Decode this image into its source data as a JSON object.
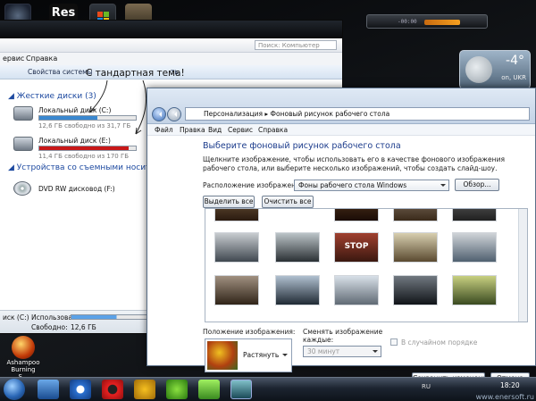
{
  "desktop": {
    "res_icon_text": "Res",
    "media_gadget_time": "-00:00",
    "weather": {
      "temperature": "-4°",
      "city": "on, UKR"
    }
  },
  "explorer": {
    "address_search_placeholder": "Поиск: Компьютер",
    "menu": [
      "ервис",
      "Справка"
    ],
    "toolbar": [
      "Свойства системы",
      "ть"
    ],
    "annotation": "С тандартная тема!",
    "hdd_section": "Жесткие диски (3)",
    "drives": [
      {
        "name": "Локальный диск (C:)",
        "free": "12,6 ГБ свободно из 31,7 ГБ",
        "used_fraction": 0.6,
        "bar_color": "#3a88d0"
      },
      {
        "name": "Локальный диск (E:)",
        "free": "11,4 ГБ свободно из 170 ГБ",
        "used_fraction": 0.93,
        "bar_color": "#c81818"
      }
    ],
    "removable_section": "Устройства со съемными носителя",
    "dvd_name": "DVD RW дисковод (F:)",
    "status": {
      "disk": "иск (C:)",
      "used_label": "Использовано:",
      "free_label": "Свободно:",
      "free_value": "12,6 ГБ"
    }
  },
  "personalization": {
    "breadcrumb": [
      "Персонализация",
      "Фоновый рисунок рабочего стола"
    ],
    "menu": [
      "Файл",
      "Правка",
      "Вид",
      "Сервис",
      "Справка"
    ],
    "title": "Выберите фоновый рисунок рабочего стола",
    "description": "Щелкните изображение, чтобы использовать его в качестве фонового изображения рабочего стола, или выберите несколько изображений, чтобы создать слайд-шоу.",
    "location_label": "Расположение изображения:",
    "location_value": "Фоны рабочего стола Windows",
    "browse_button": "Обзор...",
    "select_all_button": "Выделить все",
    "clear_all_button": "Очистить все",
    "thumbnail_stop_text": "STOP",
    "position_label": "Положение изображения:",
    "position_value": "Растянуть",
    "change_label": "Сменять изображение каждые:",
    "interval_value": "30 минут",
    "random_label": "В случайном порядке",
    "save_button": "Сохранить изменения",
    "cancel_button": "Отмена"
  },
  "taskbar": {
    "ashampoo_label": "Ashampoo Burning S...",
    "lang": "RU",
    "clock": "18:20",
    "watermark": "www.enersoft.ru"
  }
}
